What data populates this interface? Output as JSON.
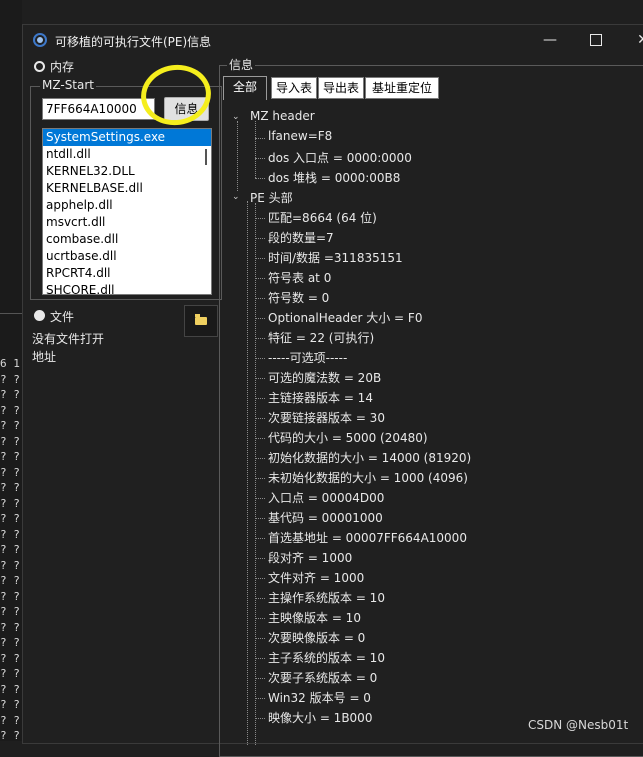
{
  "window": {
    "title": "可移植的可执行文件(PE)信息",
    "minimize_glyph": "—",
    "close_glyph": "✕"
  },
  "left_panel": {
    "memory_radio_label": "内存",
    "mz_start_group_label": "MZ-Start",
    "address_value": "7FF664A10000",
    "info_button_label": "信息",
    "modules": [
      "SystemSettings.exe",
      "ntdll.dll",
      "KERNEL32.DLL",
      "KERNELBASE.dll",
      "apphelp.dll",
      "msvcrt.dll",
      "combase.dll",
      "ucrtbase.dll",
      "RPCRT4.dll",
      "SHCORE.dll"
    ],
    "selected_module": "SystemSettings.exe",
    "file_radio_label": "文件",
    "no_file_text": "没有文件打开",
    "address_label": "地址"
  },
  "right_panel": {
    "group_label": "信息",
    "tabs": [
      "全部",
      "导入表",
      "导出表",
      "基址重定位"
    ],
    "active_tab": "全部",
    "tree": [
      {
        "label": "MZ header",
        "level": 0,
        "expanded": true
      },
      {
        "label": "lfanew=F8",
        "level": 1
      },
      {
        "label": "dos 入口点 = 0000:0000",
        "level": 1
      },
      {
        "label": "dos 堆栈 = 0000:00B8",
        "level": 1
      },
      {
        "label": "PE 头部",
        "level": 0,
        "expanded": true
      },
      {
        "label": "匹配=8664 (64 位)",
        "level": 1
      },
      {
        "label": "段的数量=7",
        "level": 1
      },
      {
        "label": "时间/数据 =311835151",
        "level": 1
      },
      {
        "label": "符号表 at 0",
        "level": 1
      },
      {
        "label": "符号数 = 0",
        "level": 1
      },
      {
        "label": "OptionalHeader 大小 = F0",
        "level": 1
      },
      {
        "label": "特征 = 22 (可执行)",
        "level": 1
      },
      {
        "label": "-----可选项-----",
        "level": 1
      },
      {
        "label": "可选的魔法数 = 20B",
        "level": 1
      },
      {
        "label": "主链接器版本 = 14",
        "level": 1
      },
      {
        "label": "次要链接器版本 = 30",
        "level": 1
      },
      {
        "label": "代码的大小 = 5000 (20480)",
        "level": 1
      },
      {
        "label": "初始化数据的大小 = 14000 (81920)",
        "level": 1
      },
      {
        "label": "未初始化数据的大小 = 1000 (4096)",
        "level": 1
      },
      {
        "label": "入口点 = 00004D00",
        "level": 1
      },
      {
        "label": "基代码 = 00001000",
        "level": 1
      },
      {
        "label": "首选基地址 = 00007FF664A10000",
        "level": 1
      },
      {
        "label": "段对齐 = 1000",
        "level": 1
      },
      {
        "label": "文件对齐 = 1000",
        "level": 1
      },
      {
        "label": "主操作系统版本 = 10",
        "level": 1
      },
      {
        "label": "主映像版本 = 10",
        "level": 1
      },
      {
        "label": "次要映像版本 = 0",
        "level": 1
      },
      {
        "label": "主子系统的版本 = 10",
        "level": 1
      },
      {
        "label": "次要子系统版本 = 0",
        "level": 1
      },
      {
        "label": "Win32 版本号 = 0",
        "level": 1
      },
      {
        "label": "映像大小 = 1B000",
        "level": 1
      }
    ]
  },
  "background": {
    "left_column_header": "6 1",
    "left_column_rows": [
      "? ?",
      "? ?",
      "? ?",
      "? ?",
      "? ?",
      "? ?",
      "? ?",
      "? ?",
      "? ?",
      "? ?",
      "? ?",
      "? ?",
      "? ?",
      "? ?",
      "? ?",
      "? ?",
      "? ?",
      "? ?",
      "? ?",
      "? ?",
      "? ?",
      "? ?",
      "? ?",
      "? ?"
    ]
  },
  "watermark": "CSDN @Nesb01t",
  "colors": {
    "highlight": "#f5ee1d",
    "selection": "#0078d7",
    "window_bg": "#202020"
  }
}
